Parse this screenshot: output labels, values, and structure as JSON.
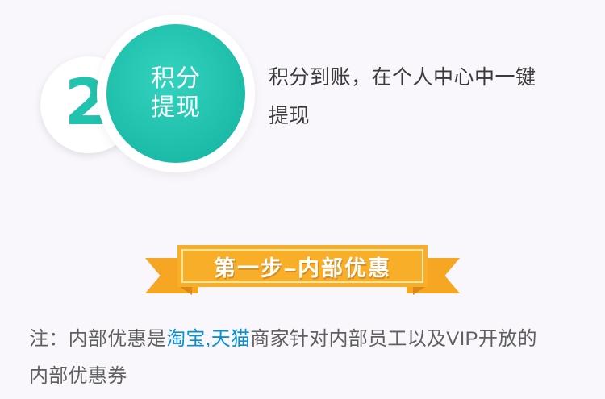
{
  "step": {
    "number": "2",
    "title_line1": "积分",
    "title_line2": "提现",
    "description_line1": "积分到账，在个人中心中一键",
    "description_line2": "提现"
  },
  "banner": {
    "label": "第一步–内部优惠"
  },
  "note": {
    "prefix": "注：内部优惠是",
    "taobao": "淘宝",
    "comma": ",",
    "tmall": "天猫",
    "suffix_line1": "商家针对内部员工以及VIP开放的",
    "line2": "内部优惠券"
  },
  "colors": {
    "teal": "#1fbfab",
    "orange": "#f9ae2a",
    "link_blue": "#0a8fd3",
    "text_dark": "#3a3a3a",
    "text_gray": "#5f5f5f",
    "background": "#f9f7fb"
  }
}
